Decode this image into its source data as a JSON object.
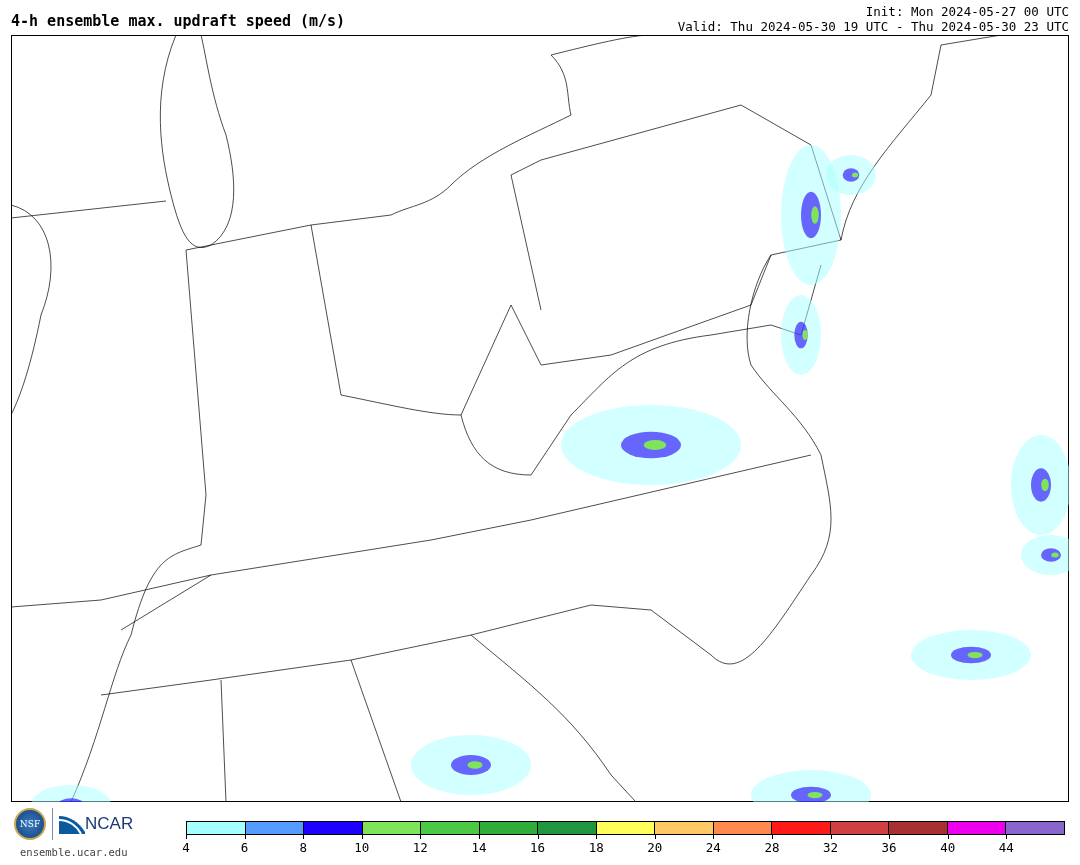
{
  "title": "4-h ensemble max. updraft speed (m/s)",
  "init": "Init: Mon 2024-05-27 00 UTC",
  "valid": "Valid: Thu 2024-05-30 19 UTC - Thu 2024-05-30 23 UTC",
  "logo": {
    "nsf": "NSF",
    "ncar": "NCAR",
    "url": "ensemble.ucar.edu"
  },
  "colorbar": [
    {
      "label": "4",
      "color": "#a6ffff"
    },
    {
      "label": "6",
      "color": "#559bff"
    },
    {
      "label": "8",
      "color": "#1e00ff"
    },
    {
      "label": "10",
      "color": "#80e45a"
    },
    {
      "label": "12",
      "color": "#4bc846"
    },
    {
      "label": "14",
      "color": "#2fad3a"
    },
    {
      "label": "16",
      "color": "#20963f"
    },
    {
      "label": "18",
      "color": "#ffff5a"
    },
    {
      "label": "20",
      "color": "#ffc864"
    },
    {
      "label": "24",
      "color": "#ff8a4e"
    },
    {
      "label": "28",
      "color": "#ff1a1a"
    },
    {
      "label": "32",
      "color": "#d04040"
    },
    {
      "label": "36",
      "color": "#a83030"
    },
    {
      "label": "40",
      "color": "#ee00ee"
    },
    {
      "label": "44",
      "color": "#8866cc"
    }
  ]
}
